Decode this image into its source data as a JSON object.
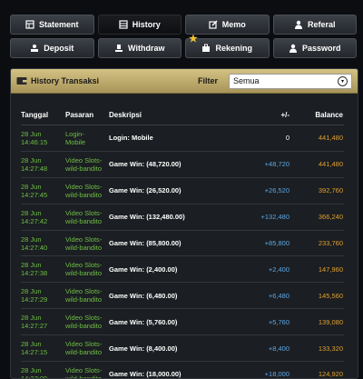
{
  "nav": {
    "row1": [
      {
        "label": "Statement",
        "icon": "statement-icon"
      },
      {
        "label": "History",
        "icon": "history-icon",
        "active": true
      },
      {
        "label": "Memo",
        "icon": "memo-icon"
      },
      {
        "label": "Referal",
        "icon": "user-icon"
      }
    ],
    "row2": [
      {
        "label": "Deposit",
        "icon": "deposit-icon"
      },
      {
        "label": "Withdraw",
        "icon": "withdraw-icon"
      },
      {
        "label": "Rekening",
        "icon": "briefcase-icon",
        "star": true
      },
      {
        "label": "Password",
        "icon": "user-icon"
      }
    ]
  },
  "panel": {
    "title": "History Transaksi",
    "filter_label": "Filter",
    "filter_value": "Semua"
  },
  "table": {
    "headers": [
      "Tanggal",
      "Pasaran",
      "Deskripsi",
      "+/-",
      "Balance"
    ],
    "rows": [
      {
        "date": "28 Jun",
        "time": "14:46:15",
        "pas1": "Login-",
        "pas2": "Mobile",
        "desc": "Login: Mobile",
        "delta": "0",
        "balance": "441,480"
      },
      {
        "date": "28 Jun",
        "time": "14:27:48",
        "pas1": "Video Slots-",
        "pas2": "wild-bandito",
        "desc": "Game Win: (48,720.00)",
        "delta": "+48,720",
        "balance": "441,480"
      },
      {
        "date": "28 Jun",
        "time": "14:27:45",
        "pas1": "Video Slots-",
        "pas2": "wild-bandito",
        "desc": "Game Win: (26,520.00)",
        "delta": "+26,520",
        "balance": "392,760"
      },
      {
        "date": "28 Jun",
        "time": "14:27:42",
        "pas1": "Video Slots-",
        "pas2": "wild-bandito",
        "desc": "Game Win: (132,480.00)",
        "delta": "+132,480",
        "balance": "366,240"
      },
      {
        "date": "28 Jun",
        "time": "14:27:40",
        "pas1": "Video Slots-",
        "pas2": "wild-bandito",
        "desc": "Game Win: (85,800.00)",
        "delta": "+85,800",
        "balance": "233,760"
      },
      {
        "date": "28 Jun",
        "time": "14:27:38",
        "pas1": "Video Slots-",
        "pas2": "wild-bandito",
        "desc": "Game Win: (2,400.00)",
        "delta": "+2,400",
        "balance": "147,960"
      },
      {
        "date": "28 Jun",
        "time": "14:27:29",
        "pas1": "Video Slots-",
        "pas2": "wild-bandito",
        "desc": "Game Win: (6,480.00)",
        "delta": "+6,480",
        "balance": "145,560"
      },
      {
        "date": "28 Jun",
        "time": "14:27:27",
        "pas1": "Video Slots-",
        "pas2": "wild-bandito",
        "desc": "Game Win: (5,760.00)",
        "delta": "+5,760",
        "balance": "139,080"
      },
      {
        "date": "28 Jun",
        "time": "14:27:15",
        "pas1": "Video Slots-",
        "pas2": "wild-bandito",
        "desc": "Game Win: (8,400.00)",
        "delta": "+8,400",
        "balance": "133,320"
      },
      {
        "date": "28 Jun",
        "time": "14:27:09",
        "pas1": "Video Slots-",
        "pas2": "wild-bandito",
        "desc": "Game Win: (18,000.00)",
        "delta": "+18,000",
        "balance": "124,920"
      }
    ]
  },
  "colors": {
    "accent": "#c9b77a",
    "date": "#6fbf45",
    "delta": "#5aa8e8",
    "balance": "#e0a030"
  }
}
